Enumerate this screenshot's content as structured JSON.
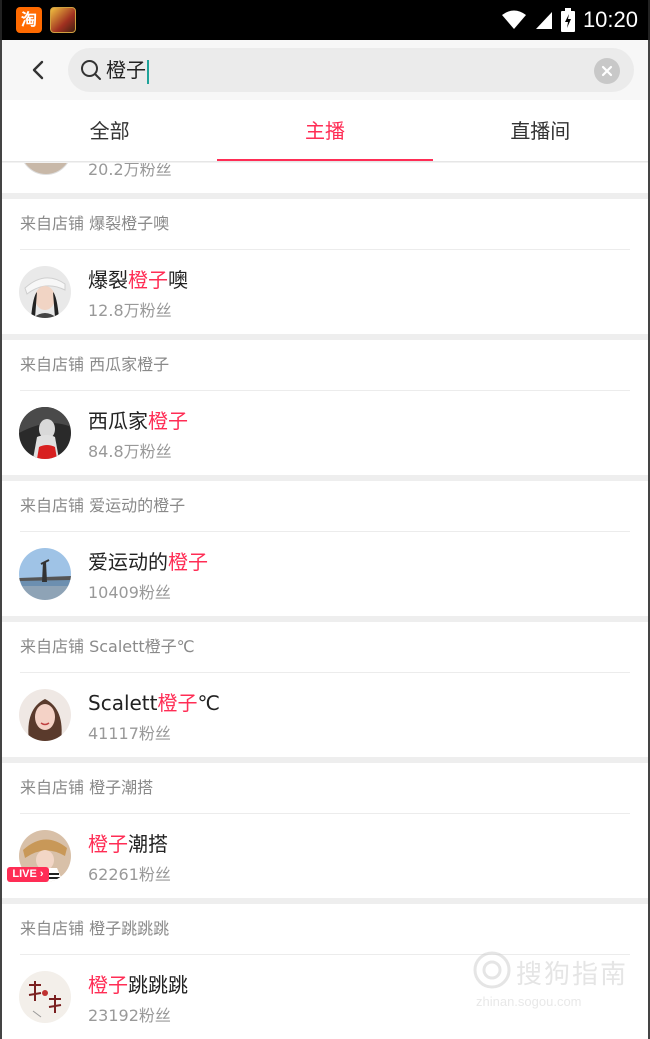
{
  "status_bar": {
    "app_icon_taobao": "淘",
    "time": "10:20"
  },
  "search": {
    "value": "橙子"
  },
  "tabs": [
    {
      "label": "全部"
    },
    {
      "label": "主播"
    },
    {
      "label": "直播间"
    }
  ],
  "partial_item": {
    "fans": "20.2万粉丝"
  },
  "items": [
    {
      "source": "来自店铺 爆裂橙子噢",
      "name_pre": "爆裂",
      "name_hl": "橙子",
      "name_post": "噢",
      "fans": "12.8万粉丝"
    },
    {
      "source": "来自店铺 西瓜家橙子",
      "name_pre": "西瓜家",
      "name_hl": "橙子",
      "name_post": "",
      "fans": "84.8万粉丝"
    },
    {
      "source": "来自店铺 爱运动的橙子",
      "name_pre": "爱运动的",
      "name_hl": "橙子",
      "name_post": "",
      "fans": "10409粉丝"
    },
    {
      "source": "来自店铺 Scalett橙子℃",
      "name_pre": "Scalett",
      "name_hl": "橙子",
      "name_post": "℃",
      "fans": "41117粉丝"
    },
    {
      "source": "来自店铺 橙子潮搭",
      "name_pre": "",
      "name_hl": "橙子",
      "name_post": "潮搭",
      "fans": "62261粉丝",
      "live": "LIVE ›"
    },
    {
      "source": "来自店铺 橙子跳跳跳",
      "name_pre": "",
      "name_hl": "橙子",
      "name_post": "跳跳跳",
      "fans": "23192粉丝"
    }
  ],
  "watermark": {
    "text": "搜狗指南",
    "url": "zhinan.sogou.com"
  },
  "colors": {
    "accent": "#ff2d55",
    "status_bar": "#000000",
    "taobao": "#ff6a00"
  }
}
